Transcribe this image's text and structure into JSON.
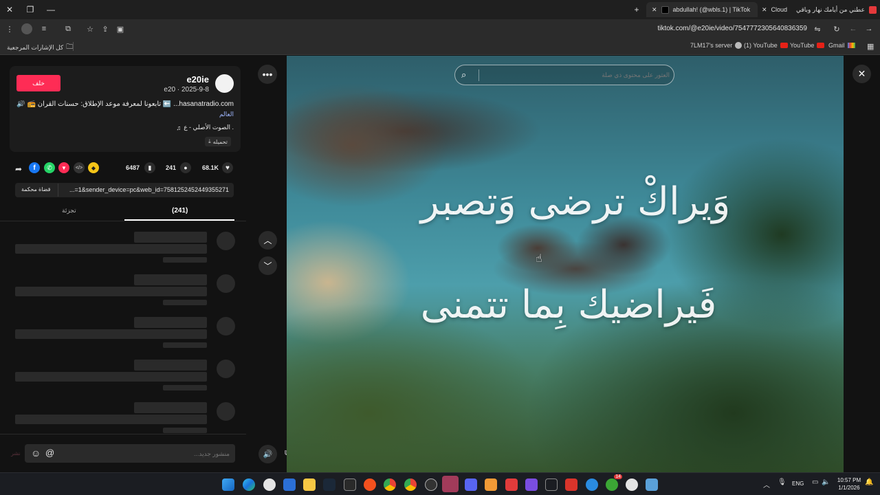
{
  "browser": {
    "tabs": [
      {
        "title": "عطني من أيامك نهار وباقي",
        "favicon_color": "#e5393b"
      },
      {
        "title": "Cloud",
        "favicon_color": "#444444"
      },
      {
        "title": "abdullah! (@wbls.1) | TikTok",
        "favicon_color": "#111111"
      }
    ],
    "url": "tiktok.com/@e20ie/video/7547772305640836359",
    "bookmarks": [
      {
        "label": "كل الإشارات المرجعية",
        "icon": "folder-icon"
      },
      {
        "label": "7LM17's server",
        "icon": "globe-icon"
      },
      {
        "label": "(1) YouTube",
        "icon": "youtube-icon"
      },
      {
        "label": "YouTube",
        "icon": "youtube-icon"
      },
      {
        "label": "Gmail",
        "icon": "gmail-icon"
      }
    ]
  },
  "author": {
    "username": "e20ie",
    "meta": "e20 · 2025-9-8",
    "follow_label": "خلف",
    "description_line1": "hasanatradio.com... ⬅️ تابعونا لمعرفة موعد الإطلاق: حسنات القرآن 📻 🔊",
    "description_line2": "العالم",
    "sound": "الصوت الأصلي - ع .",
    "download_label": "تحميله"
  },
  "stats": {
    "likes": "68.1K",
    "comments": "241",
    "saves": "6487"
  },
  "share": {
    "link": "...=1&sender_device=pc&web_id=7581252452449355271",
    "copy_label": "قضاة محكمة"
  },
  "tabs": [
    {
      "label": "(241)"
    },
    {
      "label": "تجزئة"
    }
  ],
  "comment_input": {
    "placeholder": "منشور جديد..."
  },
  "search": {
    "placeholder": "العثور على محتوى ذي صلة"
  },
  "overlay_text": {
    "line1": "وَيراكْ ترضى وَتصبر",
    "line2": "فَيراضيك بِما تتمنى"
  },
  "taskbar": {
    "language": "ENG",
    "time": "10:57 PM",
    "date": "1/1/2026",
    "badge_count": "14"
  },
  "colors": {
    "follow": "#fe2c55",
    "accent": "#fe2c55"
  }
}
